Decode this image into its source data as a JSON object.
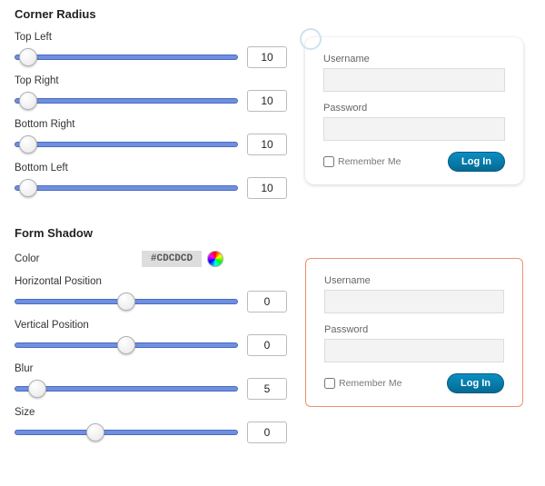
{
  "corner_radius": {
    "heading": "Corner Radius",
    "top_left": {
      "label": "Top Left",
      "value": "10",
      "pct": 6
    },
    "top_right": {
      "label": "Top Right",
      "value": "10",
      "pct": 6
    },
    "bottom_right": {
      "label": "Bottom Right",
      "value": "10",
      "pct": 6
    },
    "bottom_left": {
      "label": "Bottom Left",
      "value": "10",
      "pct": 6
    }
  },
  "form_shadow": {
    "heading": "Form Shadow",
    "color_label": "Color",
    "color_value": "#CDCDCD",
    "h_pos": {
      "label": "Horizontal Position",
      "value": "0",
      "pct": 50
    },
    "v_pos": {
      "label": "Vertical Position",
      "value": "0",
      "pct": 50
    },
    "blur": {
      "label": "Blur",
      "value": "5",
      "pct": 10
    },
    "size": {
      "label": "Size",
      "value": "0",
      "pct": 36
    }
  },
  "preview": {
    "username_label": "Username",
    "password_label": "Password",
    "remember_label": "Remember Me",
    "login_label": "Log In"
  }
}
